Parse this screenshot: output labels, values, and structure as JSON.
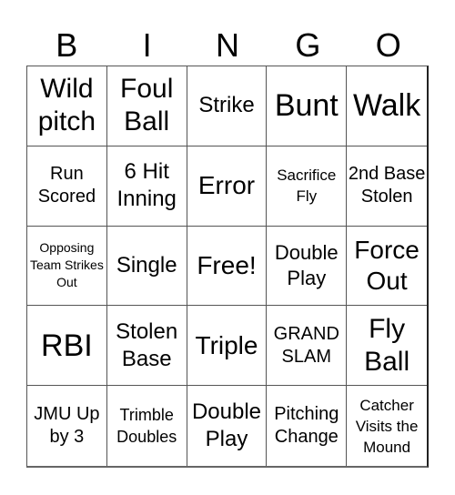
{
  "card": {
    "header": [
      "B",
      "I",
      "N",
      "G",
      "O"
    ],
    "cells": [
      [
        "Wild pitch",
        "Foul Ball",
        "Strike",
        "Bunt",
        "Walk"
      ],
      [
        "Run Scored",
        "6 Hit Inning",
        "Error",
        "Sacrifice Fly",
        "2nd Base Stolen"
      ],
      [
        "Opposing Team Strikes Out",
        "Single",
        "Free!",
        "Double Play",
        "Force Out"
      ],
      [
        "RBI",
        "Stolen Base",
        "Triple",
        "GRAND SLAM",
        "Fly Ball"
      ],
      [
        "JMU Up by 3",
        "Trimble Doubles",
        "Double Play",
        "Pitching Change",
        "Catcher Visits the Mound"
      ]
    ],
    "free_space": "Free!"
  }
}
